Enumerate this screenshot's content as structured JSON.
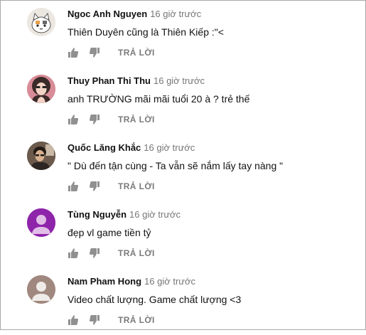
{
  "comments": [
    {
      "author": "Ngoc Anh Nguyen",
      "time": "16 giờ trước",
      "text": "Thiên Duyên cũng là Thiên Kiếp :\"<",
      "reply_label": "TRẢ LỜI",
      "avatar_color": "#e9e4df"
    },
    {
      "author": "Thuy Phan Thi Thu",
      "time": "16 giờ trước",
      "text": "anh TRƯỜNG mãi mãi tuổi 20 à ? trẻ thế",
      "reply_label": "TRẢ LỜI",
      "avatar_color": "#c67a86"
    },
    {
      "author": "Quốc Lăng Khắc",
      "time": "16 giờ trước",
      "text": "\" Dù đến tận cùng - Ta vẫn sẽ nắm lấy tay nàng \"",
      "reply_label": "TRẢ LỜI",
      "avatar_color": "#5a4a3e"
    },
    {
      "author": "Tùng Nguyễn",
      "time": "16 giờ trước",
      "text": "đẹp vl game tiền tỷ",
      "reply_label": "TRẢ LỜI",
      "avatar_color": "#8e24aa"
    },
    {
      "author": "Nam Pham Hong",
      "time": "16 giờ trước",
      "text": "Video chất lượng. Game chất lượng <3",
      "reply_label": "TRẢ LỜI",
      "avatar_color": "#a1887f"
    }
  ]
}
